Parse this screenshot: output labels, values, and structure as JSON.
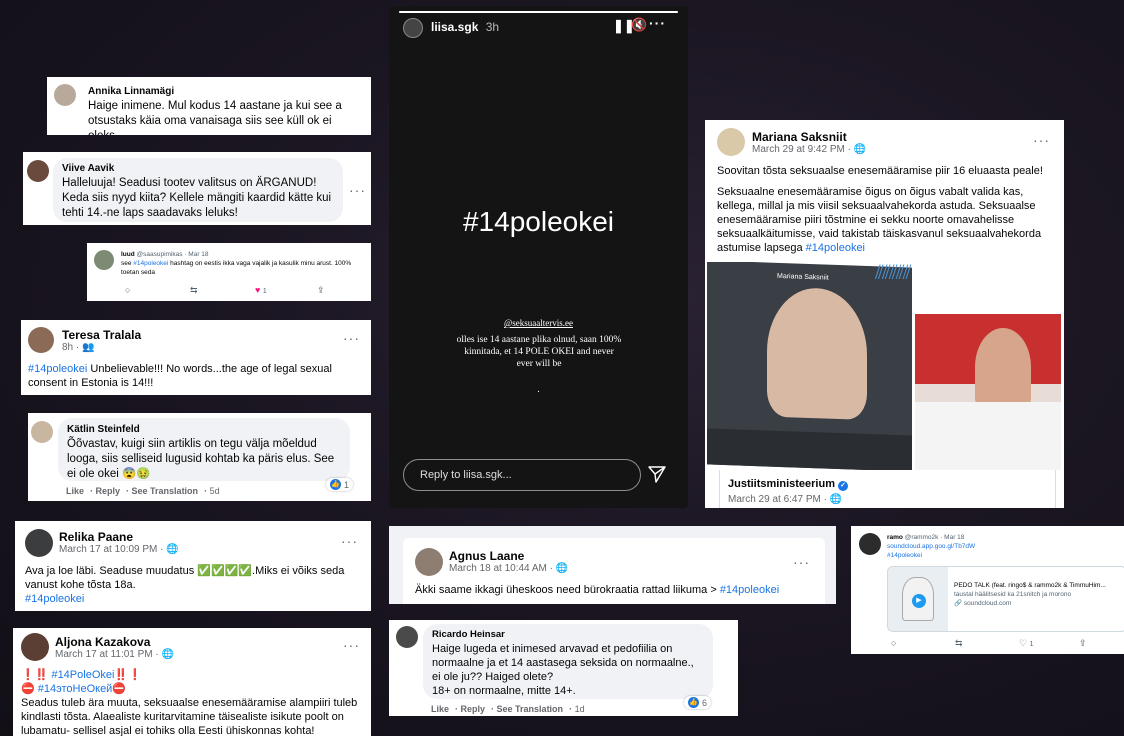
{
  "colors": {
    "background": "#1b1622",
    "link": "#1b74e4",
    "story_bg": "#141414"
  },
  "annika": {
    "name": "Annika Linnamägi",
    "text": "Haige inimene. Mul kodus 14 aastane ja kui see a otsustaks käia oma vanaisaga siis see küll ok ei oleks."
  },
  "viive": {
    "name": "Viive Aavik",
    "text": "Halleluuja! Seadusi tootev valitsus on ÄRGANUD! Keda siis nyyd kiita? Kellele mängiti kaardid kätte kui tehti 14.-ne laps saadavaks leluks!"
  },
  "luud": {
    "name": "luud",
    "handle": "@saasupimikas · Mar 18",
    "text_pre": "see ",
    "hashtag": "#14poleokei",
    "text_post": " hashtag on eestis ikka vaga vajalik ja kasulik minu arust. 100% toetan seda",
    "likes": "1"
  },
  "teresa": {
    "name": "Teresa Tralala",
    "time": "8h ·",
    "hashtag": "#14poleokei",
    "text": " Unbelievable!!! No words...the age of legal sexual consent in Estonia is 14!!!"
  },
  "katlin": {
    "name": "Kätlin Steinfeld",
    "text": "Õõvastav, kuigi siin artiklis on tegu välja mõeldud looga, siis selliseid lugusid kohtab ka päris elus. See ei ole okei 😨🤢",
    "actions": [
      "Like",
      "Reply",
      "See Translation"
    ],
    "time": "5d",
    "reactions": "1"
  },
  "relika": {
    "name": "Relika Paane",
    "time": "March 17 at 10:09 PM ·",
    "text": "Ava ja loe läbi. Seaduse muudatus ✅✅✅✅.Miks ei võiks seda vanust kohe tõsta 18a.",
    "hashtag": "#14poleokei"
  },
  "aljona": {
    "name": "Aljona Kazakova",
    "time": "March 17 at 11:01 PM ·",
    "line1": "❗‼️ #14PoleOkei‼️❗",
    "line2": "⛔ #14этоНеОкей⛔",
    "text": "Seadus tuleb ära muuta, seksuaalse enesemääramise alampiiri tuleb kindlasti  tõsta.  Alaealiste kuritarvitamine täisealiste isikute poolt on lubamatu- sellisel asjal ei tohiks olla Eesti ühiskonnas kohta!"
  },
  "story": {
    "user": "liisa.sgk",
    "time": "3h",
    "headline": "#14poleokei",
    "handle": "@seksuaaltervis.ee",
    "quote": "olles ise 14 aastane plika olnud, saan 100% kinnitada, et 14 POLE OKEI and never ever will be",
    "dot": ".",
    "reply_placeholder": "Reply to liisa.sgk...",
    "progress": 1.0
  },
  "mariana": {
    "name": "Mariana Saksniit",
    "time": "March 29 at 9:42 PM ·",
    "p1": "Soovitan tõsta seksuaalse enesemääramise piir 16 eluaasta peale!",
    "p2": "Seksuaalne enesemääramise õigus on õigus vabalt valida kas, kellega, millal ja mis viisil seksuaalvahekorda astuda. Seksuaalse enesemääramise piiri tõstmine ei sekku noorte omavahelisse seksuaalkäitumisse, vaid takistab täiskasvanul seksuaalvahekorda astumise lapsega ",
    "hashtag": "#14poleokei",
    "video_caption": "Mariana Saksniit",
    "shared_name": "Justiitsministeerium",
    "shared_time": "March 29 at 6:47 PM ·"
  },
  "agnus": {
    "name": "Agnus Laane",
    "time": "March 18 at 10:44 AM ·",
    "text": "Äkki saame ikkagi üheskoos need bürokraatia rattad liikuma > ",
    "hashtag": "#14poleokei"
  },
  "ricardo": {
    "name": "Ricardo Heinsar",
    "text": "Haige lugeda et inimesed arvavad et pedofiilia on normaalne ja et 14 aastasega seksida on normaalne., ei ole ju?? Haiged olete?\n18+ on normaalne, mitte 14+.",
    "actions": [
      "Like",
      "Reply",
      "See Translation"
    ],
    "time": "1d",
    "reactions": "6"
  },
  "ramo": {
    "name": "ramo",
    "handle": "@rammo2k · Mar 18",
    "link": "soundcloud.app.goo.gl/Tb7dW",
    "hashtag": "#14poleokei",
    "card_title": "PEDO TALK (feat. ringo$ & rammo2k & TimmuHim...",
    "card_desc": "taustal hääl​itsesid ka 21snitch ja morono",
    "card_domain": "soundcloud.com",
    "likes": "1"
  },
  "icons": [
    "more-icon",
    "globe-icon",
    "friends-icon",
    "pause-icon",
    "mute-icon",
    "send-icon",
    "like-reaction-icon",
    "reply-icon",
    "retweet-icon",
    "heart-icon",
    "share-icon",
    "verified-icon",
    "play-icon",
    "link-icon"
  ]
}
